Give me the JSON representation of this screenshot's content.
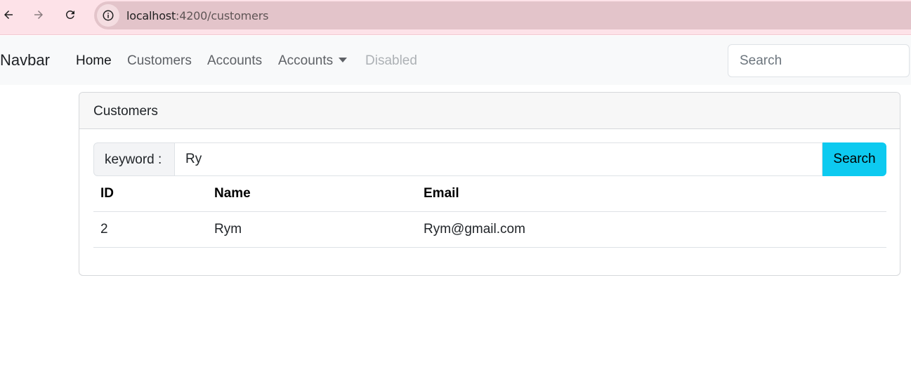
{
  "browser": {
    "url_host": "localhost",
    "url_path": ":4200/customers"
  },
  "navbar": {
    "brand": "Navbar",
    "links": [
      {
        "label": "Home"
      },
      {
        "label": "Customers"
      },
      {
        "label": "Accounts"
      },
      {
        "label": "Accounts"
      },
      {
        "label": "Disabled"
      }
    ],
    "search_placeholder": "Search"
  },
  "card": {
    "title": "Customers",
    "search": {
      "label": "keyword :",
      "value": "Ry",
      "button_label": "Search"
    },
    "table": {
      "headers": [
        "ID",
        "Name",
        "Email"
      ],
      "rows": [
        {
          "id": "2",
          "name": "Rym",
          "email": "Rym@gmail.com"
        }
      ]
    }
  },
  "colors": {
    "browser_chrome": "#fde2e8",
    "navbar_bg": "#f8f9fa",
    "search_button": "#0dcaf0"
  }
}
